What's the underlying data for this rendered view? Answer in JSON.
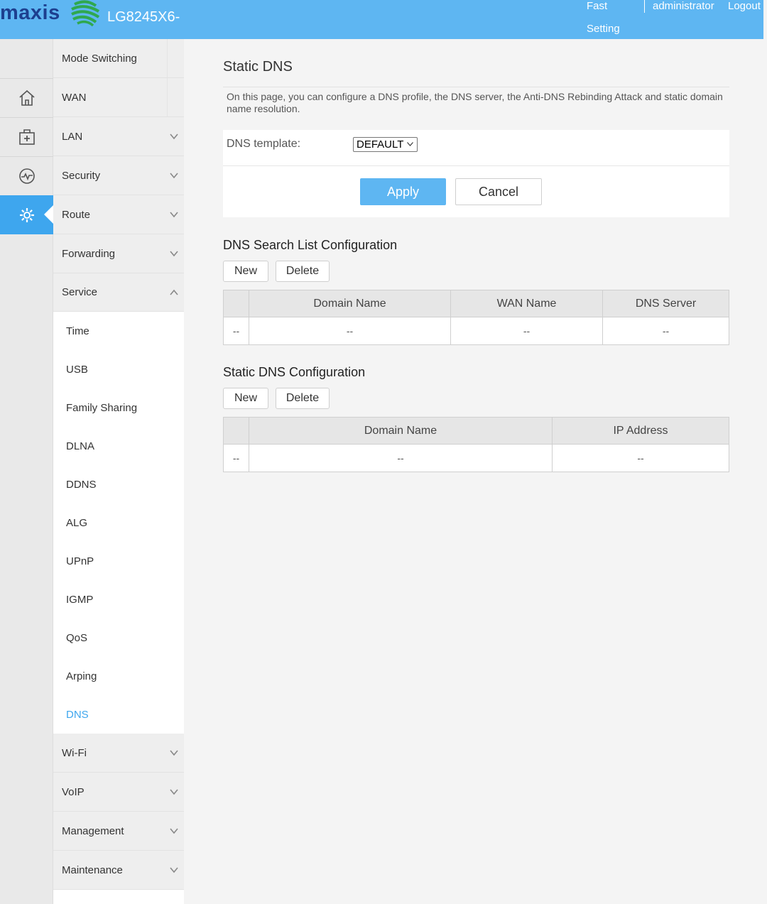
{
  "header": {
    "brand": "maxis",
    "model": "LG8245X6-",
    "fast_setting_line1": "Fast",
    "fast_setting_line2": "Setting",
    "user": "administrator",
    "logout": "Logout",
    "brand_color": "#1d3f8f",
    "bar_color": "#5eb6f2"
  },
  "rail": {
    "icons": [
      "home-icon",
      "add-device-icon",
      "diagnostic-icon",
      "gear-icon"
    ],
    "active": "gear-icon",
    "accent": "#3ea6ee"
  },
  "menu": {
    "items": [
      {
        "label": "Mode Switching"
      },
      {
        "label": "WAN"
      },
      {
        "label": "LAN",
        "chevron": "down"
      },
      {
        "label": "Security",
        "chevron": "down"
      },
      {
        "label": "Route",
        "chevron": "down"
      },
      {
        "label": "Forwarding",
        "chevron": "down"
      },
      {
        "label": "Service",
        "chevron": "up"
      },
      {
        "label": "Wi-Fi",
        "chevron": "down"
      },
      {
        "label": "VoIP",
        "chevron": "down"
      },
      {
        "label": "Management",
        "chevron": "down"
      },
      {
        "label": "Maintenance",
        "chevron": "down"
      }
    ],
    "service_sub": [
      "Time",
      "USB",
      "Family Sharing",
      "DLNA",
      "DDNS",
      "ALG",
      "UPnP",
      "IGMP",
      "QoS",
      "Arping",
      "DNS"
    ],
    "active_sub": "DNS"
  },
  "main": {
    "title": "Static DNS",
    "description": "On this page, you can configure a DNS profile, the DNS server, the Anti-DNS Rebinding Attack and static domain name resolution.",
    "dns_template_label": "DNS template:",
    "dns_template_value": "DEFAULT",
    "apply": "Apply",
    "cancel": "Cancel",
    "search_list": {
      "title": "DNS Search List Configuration",
      "new": "New",
      "delete": "Delete",
      "columns": [
        "",
        "Domain Name",
        "WAN Name",
        "DNS Server"
      ],
      "row": [
        "--",
        "--",
        "--",
        "--"
      ]
    },
    "static_dns": {
      "title": "Static DNS Configuration",
      "new": "New",
      "delete": "Delete",
      "columns": [
        "",
        "Domain Name",
        "IP Address"
      ],
      "row": [
        "--",
        "--",
        "--"
      ]
    }
  }
}
